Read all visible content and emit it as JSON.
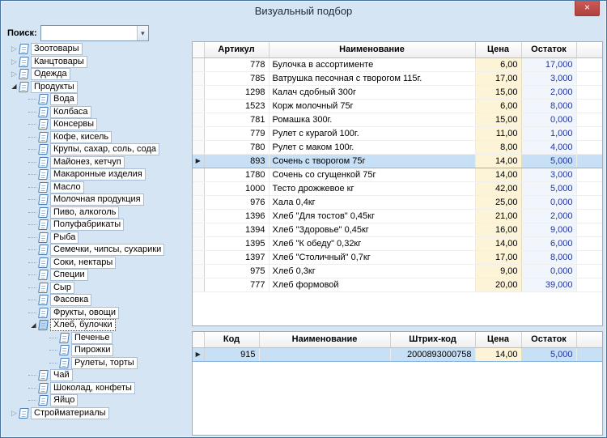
{
  "window": {
    "title": "Визуальный подбор",
    "close_glyph": "×"
  },
  "icons": {
    "dropdown": "▾",
    "collapsed_twisty": "▷",
    "expanded_twisty": "◢",
    "current_row_marker": "▶"
  },
  "colors": {
    "window_bg": "#d6e5f4",
    "close_button": "#cc5a54",
    "price_column_bg": "#fdf3d6",
    "stock_text": "#2333a0",
    "selection_bg": "#c7e0f5"
  },
  "search": {
    "label": "Поиск:",
    "value": ""
  },
  "tree": {
    "items": [
      {
        "label": "Зоотовары",
        "level": 0,
        "twisty": "collapsed"
      },
      {
        "label": "Канцтовары",
        "level": 0,
        "twisty": "collapsed"
      },
      {
        "label": "Одежда",
        "level": 0,
        "twisty": "collapsed"
      },
      {
        "label": "Продукты",
        "level": 0,
        "twisty": "expanded"
      },
      {
        "label": "Вода",
        "level": 1
      },
      {
        "label": "Колбаса",
        "level": 1
      },
      {
        "label": "Консервы",
        "level": 1
      },
      {
        "label": "Кофе, кисель",
        "level": 1
      },
      {
        "label": "Крупы, сахар, соль, сода",
        "level": 1
      },
      {
        "label": "Майонез, кетчуп",
        "level": 1
      },
      {
        "label": "Макаронные изделия",
        "level": 1
      },
      {
        "label": "Масло",
        "level": 1
      },
      {
        "label": "Молочная продукция",
        "level": 1
      },
      {
        "label": "Пиво, алкоголь",
        "level": 1
      },
      {
        "label": "Полуфабрикаты",
        "level": 1
      },
      {
        "label": "Рыба",
        "level": 1
      },
      {
        "label": "Семечки, чипсы, сухарики",
        "level": 1
      },
      {
        "label": "Соки, нектары",
        "level": 1
      },
      {
        "label": "Специи",
        "level": 1
      },
      {
        "label": "Сыр",
        "level": 1
      },
      {
        "label": "Фасовка",
        "level": 1
      },
      {
        "label": "Фрукты, овощи",
        "level": 1
      },
      {
        "label": "Хлеб, булочки",
        "level": 1,
        "twisty": "expanded",
        "selected": true
      },
      {
        "label": "Печенье",
        "level": 2
      },
      {
        "label": "Пирожки",
        "level": 2
      },
      {
        "label": "Рулеты, торты",
        "level": 2
      },
      {
        "label": "Чай",
        "level": 1
      },
      {
        "label": "Шоколад, конфеты",
        "level": 1
      },
      {
        "label": "Яйцо",
        "level": 1
      },
      {
        "label": "Стройматериалы",
        "level": 0,
        "twisty": "collapsed"
      }
    ]
  },
  "products_table": {
    "columns": [
      "Артикул",
      "Наименование",
      "Цена",
      "Остаток"
    ],
    "rows": [
      {
        "article": "778",
        "name": "Булочка в ассортименте",
        "price": "6,00",
        "stock": "17,000"
      },
      {
        "article": "785",
        "name": "Ватрушка песочная с творогом 115г.",
        "price": "17,00",
        "stock": "3,000"
      },
      {
        "article": "1298",
        "name": "Калач сдобный 300г",
        "price": "15,00",
        "stock": "2,000"
      },
      {
        "article": "1523",
        "name": "Корж молочный 75г",
        "price": "6,00",
        "stock": "8,000"
      },
      {
        "article": "781",
        "name": "Ромашка 300г.",
        "price": "15,00",
        "stock": "0,000"
      },
      {
        "article": "779",
        "name": "Рулет с курагой 100г.",
        "price": "11,00",
        "stock": "1,000"
      },
      {
        "article": "780",
        "name": "Рулет с маком 100г.",
        "price": "8,00",
        "stock": "4,000"
      },
      {
        "article": "893",
        "name": "Сочень с творогом 75г",
        "price": "14,00",
        "stock": "5,000",
        "selected": true
      },
      {
        "article": "1780",
        "name": "Сочень со сгущенкой 75г",
        "price": "14,00",
        "stock": "3,000"
      },
      {
        "article": "1000",
        "name": "Тесто дрожжевое кг",
        "price": "42,00",
        "stock": "5,000"
      },
      {
        "article": "976",
        "name": "Хала 0,4кг",
        "price": "25,00",
        "stock": "0,000"
      },
      {
        "article": "1396",
        "name": "Хлеб \"Для тостов\" 0,45кг",
        "price": "21,00",
        "stock": "2,000"
      },
      {
        "article": "1394",
        "name": "Хлеб \"Здоровье\" 0,45кг",
        "price": "16,00",
        "stock": "9,000"
      },
      {
        "article": "1395",
        "name": "Хлеб \"К обеду\" 0,32кг",
        "price": "14,00",
        "stock": "6,000"
      },
      {
        "article": "1397",
        "name": "Хлеб \"Столичный\" 0,7кг",
        "price": "17,00",
        "stock": "8,000"
      },
      {
        "article": "975",
        "name": "Хлеб 0,3кг",
        "price": "9,00",
        "stock": "0,000"
      },
      {
        "article": "777",
        "name": "Хлеб формовой",
        "price": "20,00",
        "stock": "39,000"
      }
    ]
  },
  "detail_table": {
    "columns": [
      "Код",
      "Наименование",
      "Штрих-код",
      "Цена",
      "Остаток"
    ],
    "rows": [
      {
        "code": "915",
        "name": "",
        "barcode": "2000893000758",
        "price": "14,00",
        "stock": "5,000",
        "selected": true
      }
    ]
  }
}
